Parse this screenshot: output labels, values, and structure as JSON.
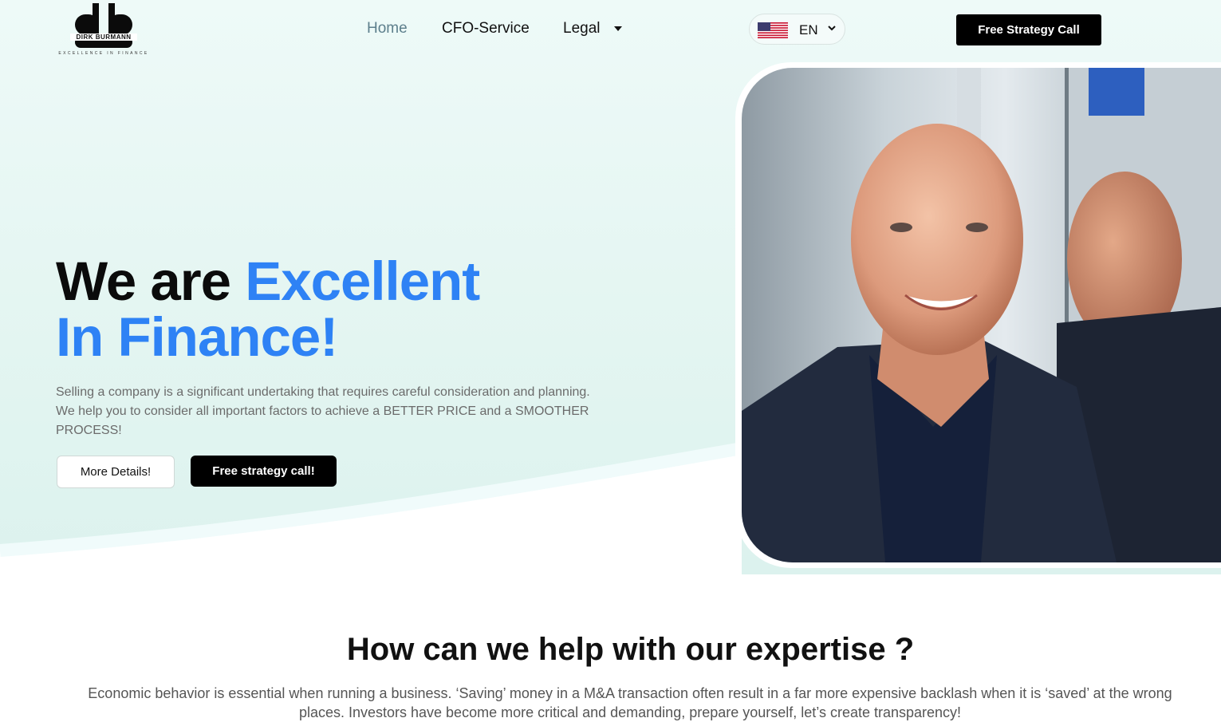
{
  "brand": {
    "name": "DIRK BURMANN",
    "tagline": "EXCELLENCE IN FINANCE",
    "logo_icon": "db-monogram-logo"
  },
  "nav": {
    "items": [
      {
        "label": "Home",
        "active": true
      },
      {
        "label": "CFO-Service",
        "active": false
      },
      {
        "label": "Legal",
        "active": false,
        "dropdown": true
      }
    ]
  },
  "language": {
    "code": "EN",
    "flag_icon": "us-flag-icon",
    "chevron_icon": "chevron-down-icon"
  },
  "header_cta": "Free Strategy Call",
  "hero": {
    "title_plain": "We are",
    "title_accent_1": "Excellent",
    "title_accent_2": "In Finance!",
    "description": "Selling a company is a significant undertaking that requires careful consideration and planning. We help you to consider all important factors to achieve a BETTER PRICE and a SMOOTHER PROCESS!",
    "btn_details": "More Details!",
    "btn_call": "Free strategy call!"
  },
  "section": {
    "title": "How can we help with our expertise ?",
    "text": "Economic behavior is essential when running a business. ‘Saving’ money in a M&A transaction often result in a far more expensive backlash when it is ‘saved’ at the wrong places. Investors have become more critical and demanding, prepare yourself, let’s create transparency!"
  },
  "colors": {
    "accent": "#2e82f5",
    "dark": "#000000",
    "hero_bg": "#e3f5f1",
    "nav_active": "#5d7f8c"
  }
}
